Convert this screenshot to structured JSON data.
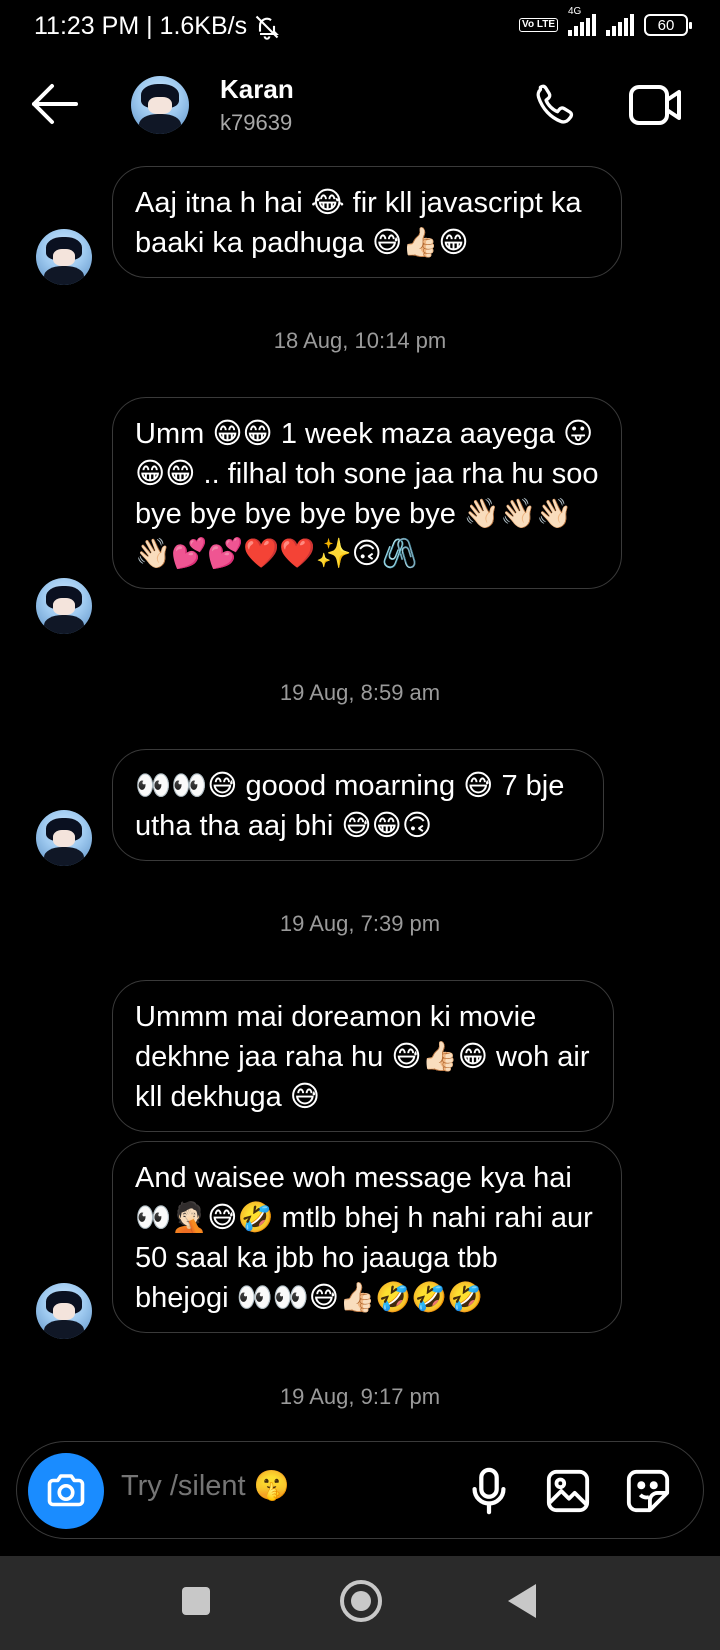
{
  "status_bar": {
    "time_speed": "11:23 PM | 1.6KB/s",
    "network_label": "4G",
    "volte_label": "Vo LTE",
    "battery": "60"
  },
  "header": {
    "name": "Karan",
    "username": "k79639"
  },
  "messages": [
    {
      "text": "Aaj itna h hai 😂 fir kll javascript ka baaki ka padhuga 😅👍🏻😁"
    },
    {
      "text": "Umm 😁😁  1 week maza aayega 😛😁😁 .. filhal toh sone jaa rha hu soo bye bye bye bye bye bye 👋🏻👋🏻👋🏻👋🏻💕💕❤️❤️✨🙃🖇️"
    },
    {
      "text": "👀👀😅 goood moarning 😅 7 bje utha tha aaj bhi 😅😁🙃"
    },
    {
      "text": "Ummm mai doreamon ki movie dekhne jaa raha hu 😅👍🏻😁 woh air kll dekhuga 😅"
    },
    {
      "text": "And waisee woh message kya hai 👀🤦🏻😅🤣 mtlb bhej h nahi rahi aur 50 saal ka jbb ho jaauga tbb bhejogi 👀👀😅👍🏻🤣🤣🤣"
    }
  ],
  "timestamps": [
    "18 Aug, 10:14 pm",
    "19 Aug, 8:59 am",
    "19 Aug, 7:39 pm",
    "19 Aug, 9:17 pm"
  ],
  "composer": {
    "placeholder": "Try /silent 🤫"
  },
  "colors": {
    "background": "#000000",
    "accent": "#1a8cff",
    "bubble_border": "#3a3a3a",
    "secondary_text": "#9a9a9a",
    "nav_bar": "#2a2a2a"
  }
}
